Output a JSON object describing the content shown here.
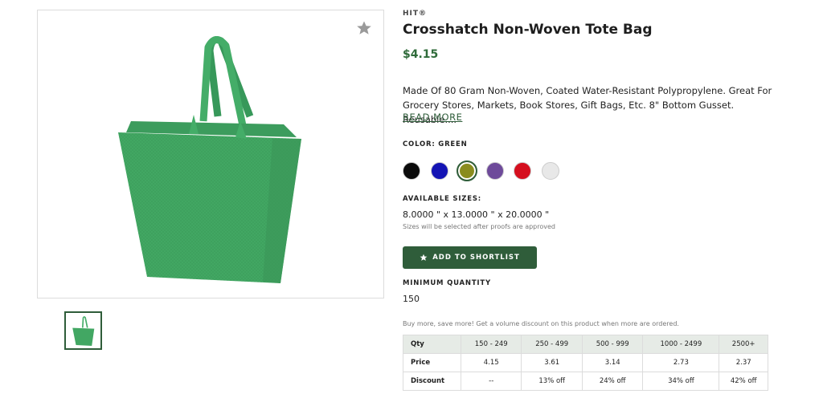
{
  "product": {
    "brand": "HIT®",
    "title": "Crosshatch Non-Woven Tote Bag",
    "price": "$4.15",
    "description": "Made Of 80 Gram Non-Woven, Coated Water-Resistant Polypropylene. Great For Grocery Stores, Markets, Book Stores, Gift Bags, Etc. 8\" Bottom Gusset. Reusable....",
    "read_more": "READ MORE",
    "bag_color": "#3ea35f"
  },
  "color": {
    "label": "COLOR: GREEN",
    "swatches": [
      {
        "name": "black",
        "hex": "#0b0b0b"
      },
      {
        "name": "blue",
        "hex": "#1414b4"
      },
      {
        "name": "green",
        "hex": "#8a8c1e",
        "selected": true
      },
      {
        "name": "purple",
        "hex": "#6e4a9a"
      },
      {
        "name": "red",
        "hex": "#d50f1e"
      },
      {
        "name": "white",
        "hex": "#e8e8e8"
      }
    ]
  },
  "sizes": {
    "label": "AVAILABLE SIZES:",
    "value": "8.0000 \" x 13.0000 \" x 20.0000 \"",
    "note": "Sizes will be selected after proofs are approved"
  },
  "shortlist": {
    "label": "ADD TO SHORTLIST",
    "icon": "star-icon"
  },
  "min_quantity": {
    "label": "MINIMUM QUANTITY",
    "value": "150"
  },
  "pricing": {
    "note": "Buy more, save more! Get a volume discount on this product when more are ordered.",
    "header": [
      "Qty",
      "150 - 249",
      "250 - 499",
      "500 - 999",
      "1000 - 2499",
      "2500+"
    ],
    "price_row": [
      "Price",
      "4.15",
      "3.61",
      "3.14",
      "2.73",
      "2.37"
    ],
    "discount_row": [
      "Discount",
      "--",
      "13% off",
      "24% off",
      "34% off",
      "42% off"
    ]
  },
  "colors": {
    "accent": "#2f5d3a",
    "price": "#2f6b3a"
  }
}
